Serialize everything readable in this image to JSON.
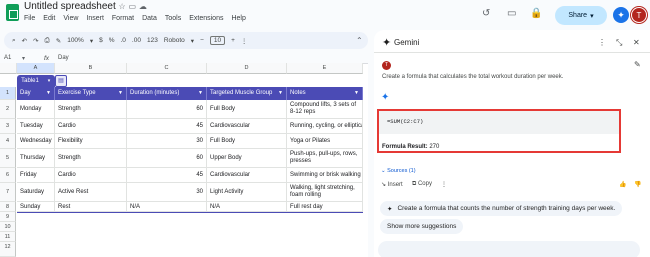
{
  "app": {
    "doc_title": "Untitled spreadsheet",
    "share_label": "Share",
    "avatar_letter": "T",
    "accent": "#4b4bb5"
  },
  "menu": [
    "File",
    "Edit",
    "View",
    "Insert",
    "Format",
    "Data",
    "Tools",
    "Extensions",
    "Help"
  ],
  "toolbar": {
    "zoom": "100%",
    "currency": "$",
    "percent": "%",
    "dec_dec": ".0",
    "dec_inc": ".00",
    "number_fmt": "123",
    "font": "Roboto",
    "font_size": "10",
    "minus": "−",
    "plus": "+"
  },
  "formula_bar": {
    "cell_ref": "A1",
    "fx": "fx",
    "value": "Day"
  },
  "columns": [
    "A",
    "B",
    "C",
    "D",
    "E"
  ],
  "rows": [
    "1",
    "2",
    "3",
    "4",
    "5",
    "6",
    "7",
    "8",
    "9",
    "10",
    "11",
    "12"
  ],
  "table": {
    "name": "Table1",
    "headers": [
      "Day",
      "Exercise Type",
      "Duration (minutes)",
      "Targeted Muscle Group",
      "Notes"
    ],
    "rows": [
      [
        "Monday",
        "Strength",
        "60",
        "Full Body",
        "Compound lifts, 3 sets of 8-12 reps"
      ],
      [
        "Tuesday",
        "Cardio",
        "45",
        "Cardiovascular",
        "Running, cycling, or elliptical"
      ],
      [
        "Wednesday",
        "Flexibility",
        "30",
        "Full Body",
        "Yoga or Pilates"
      ],
      [
        "Thursday",
        "Strength",
        "60",
        "Upper Body",
        "Push-ups, pull-ups, rows, presses"
      ],
      [
        "Friday",
        "Cardio",
        "45",
        "Cardiovascular",
        "Swimming or brisk walking"
      ],
      [
        "Saturday",
        "Active Rest",
        "30",
        "Light Activity",
        "Walking, light stretching, foam rolling"
      ],
      [
        "Sunday",
        "Rest",
        "N/A",
        "N/A",
        "Full rest day"
      ]
    ]
  },
  "gemini": {
    "title": "Gemini",
    "user_initial": "T",
    "prompt": "Create a formula that calculates the total workout duration per week.",
    "code": "=SUM(C2:C7)",
    "result_label": "Formula Result:",
    "result_value": "270",
    "sources": "Sources (1)",
    "insert": "Insert",
    "copy": "Copy",
    "suggestion1": "Create a formula that counts the number of strength training days per week.",
    "suggestion2": "Show more suggestions"
  }
}
